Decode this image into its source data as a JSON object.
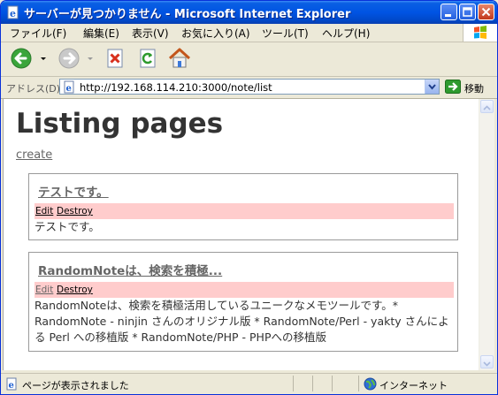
{
  "window": {
    "title": "サーバーが見つかりません - Microsoft Internet Explorer"
  },
  "menu": {
    "items": [
      {
        "label": "ファイル(F)"
      },
      {
        "label": "編集(E)"
      },
      {
        "label": "表示(V)"
      },
      {
        "label": "お気に入り(A)"
      },
      {
        "label": "ツール(T)"
      },
      {
        "label": "ヘルプ(H)"
      }
    ]
  },
  "toolbar": {
    "icons": [
      "back-icon",
      "forward-icon",
      "stop-icon",
      "refresh-icon",
      "home-icon"
    ]
  },
  "address": {
    "label": "アドレス(D)",
    "url": "http://192.168.114.210:3000/note/list",
    "go_label": "移動"
  },
  "page": {
    "heading": "Listing pages",
    "create_label": "create",
    "notes": [
      {
        "title": "テストです。",
        "edit_label": "Edit",
        "destroy_label": "Destroy",
        "body": "テストです。"
      },
      {
        "title": "RandomNoteは、検索を積極...",
        "edit_label": "Edit",
        "destroy_label": "Destroy",
        "body": "RandomNoteは、検索を積極活用しているユニークなメモツールです。* RandomNote - ninjin さんのオリジナル版 * RandomNote/Perl - yakty さんによる Perl への移植版 * RandomNote/PHP - PHPへの移植版"
      }
    ]
  },
  "status": {
    "text": "ページが表示されました",
    "zone": "インターネット"
  },
  "colors": {
    "titlebar": "#0054E3",
    "action_bar": "#FFCCCC",
    "link": "#666666"
  }
}
